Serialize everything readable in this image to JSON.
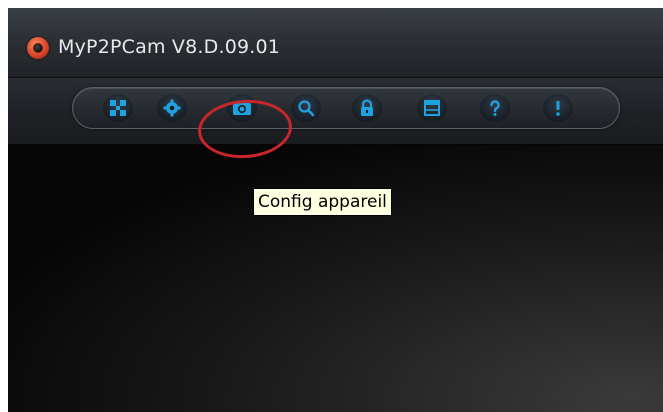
{
  "window": {
    "title": "MyP2PCam  V8.D.09.01"
  },
  "toolbar": {
    "buttons": [
      {
        "name": "fullscreen-icon"
      },
      {
        "name": "settings-gear-icon"
      },
      {
        "name": "camera-icon"
      },
      {
        "name": "search-icon"
      },
      {
        "name": "lock-icon"
      },
      {
        "name": "window-icon"
      },
      {
        "name": "help-icon"
      },
      {
        "name": "info-icon"
      }
    ],
    "icon_color": "#1ea3e0",
    "highlight_color": "#c8262a"
  },
  "tooltip": {
    "text": "Config appareil"
  }
}
